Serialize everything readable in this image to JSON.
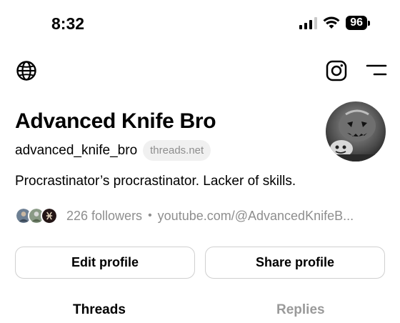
{
  "status_bar": {
    "time": "8:32",
    "battery": "96",
    "icons": [
      "signal-icon",
      "wifi-icon",
      "battery-icon"
    ]
  },
  "nav": {
    "icons": [
      "globe-icon",
      "instagram-icon",
      "menu-icon"
    ]
  },
  "profile": {
    "display_name": "Advanced Knife Bro",
    "handle": "advanced_knife_bro",
    "domain_badge": "threads.net",
    "bio": "Procrastinator’s procrastinator. Lacker of skills.",
    "followers": "226 followers",
    "separator": "•",
    "link": "youtube.com/@AdvancedKnifeB..."
  },
  "buttons": {
    "edit": "Edit profile",
    "share": "Share profile"
  },
  "tabs": [
    {
      "label": "Threads",
      "active": true
    },
    {
      "label": "Replies",
      "active": false
    }
  ],
  "colors": {
    "muted_text": "#8e8e8e",
    "border": "#d0d0d0",
    "badge_bg": "#f0f0f0"
  }
}
